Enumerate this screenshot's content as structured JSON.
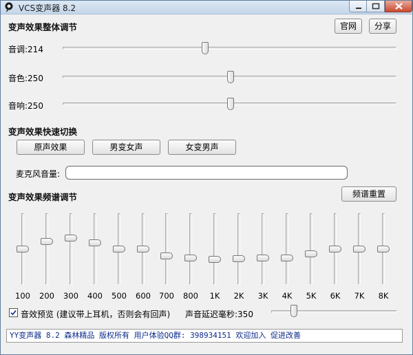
{
  "window": {
    "title": "VCS变声器 8.2"
  },
  "header": {
    "section_title": "变声效果整体调节",
    "site_button": "官网",
    "share_button": "分享"
  },
  "sliders": {
    "pitch": {
      "label": "音调:214",
      "value": 214
    },
    "timbre": {
      "label": "音色:250",
      "value": 250
    },
    "echo": {
      "label": "音响:250",
      "value": 250
    }
  },
  "quick_switch": {
    "section_title": "变声效果快速切换",
    "original": "原声效果",
    "male_to_female": "男变女声",
    "female_to_male": "女变男声"
  },
  "mic": {
    "label": "麦克风音量:"
  },
  "equalizer": {
    "section_title": "变声效果频谱调节",
    "reset_button": "频谱重置",
    "bands": [
      {
        "label": "100",
        "level": 0.5
      },
      {
        "label": "200",
        "level": 0.62
      },
      {
        "label": "300",
        "level": 0.67
      },
      {
        "label": "400",
        "level": 0.6
      },
      {
        "label": "500",
        "level": 0.5
      },
      {
        "label": "600",
        "level": 0.5
      },
      {
        "label": "700",
        "level": 0.39
      },
      {
        "label": "800",
        "level": 0.36
      },
      {
        "label": "1K",
        "level": 0.34
      },
      {
        "label": "2K",
        "level": 0.35
      },
      {
        "label": "3K",
        "level": 0.36
      },
      {
        "label": "4K",
        "level": 0.36
      },
      {
        "label": "5K",
        "level": 0.43
      },
      {
        "label": "6K",
        "level": 0.5
      },
      {
        "label": "7K",
        "level": 0.5
      },
      {
        "label": "8K",
        "level": 0.5
      }
    ]
  },
  "preview": {
    "checked": true,
    "label": "音效预览 (建议带上耳机，否则会有回声)"
  },
  "delay": {
    "label": "声音延迟毫秒:350",
    "value": 350
  },
  "status": {
    "text": "YY变声器 8.2 森林精品 版权所有 用户体验QQ群: 398934151 欢迎加入 促进改善"
  }
}
